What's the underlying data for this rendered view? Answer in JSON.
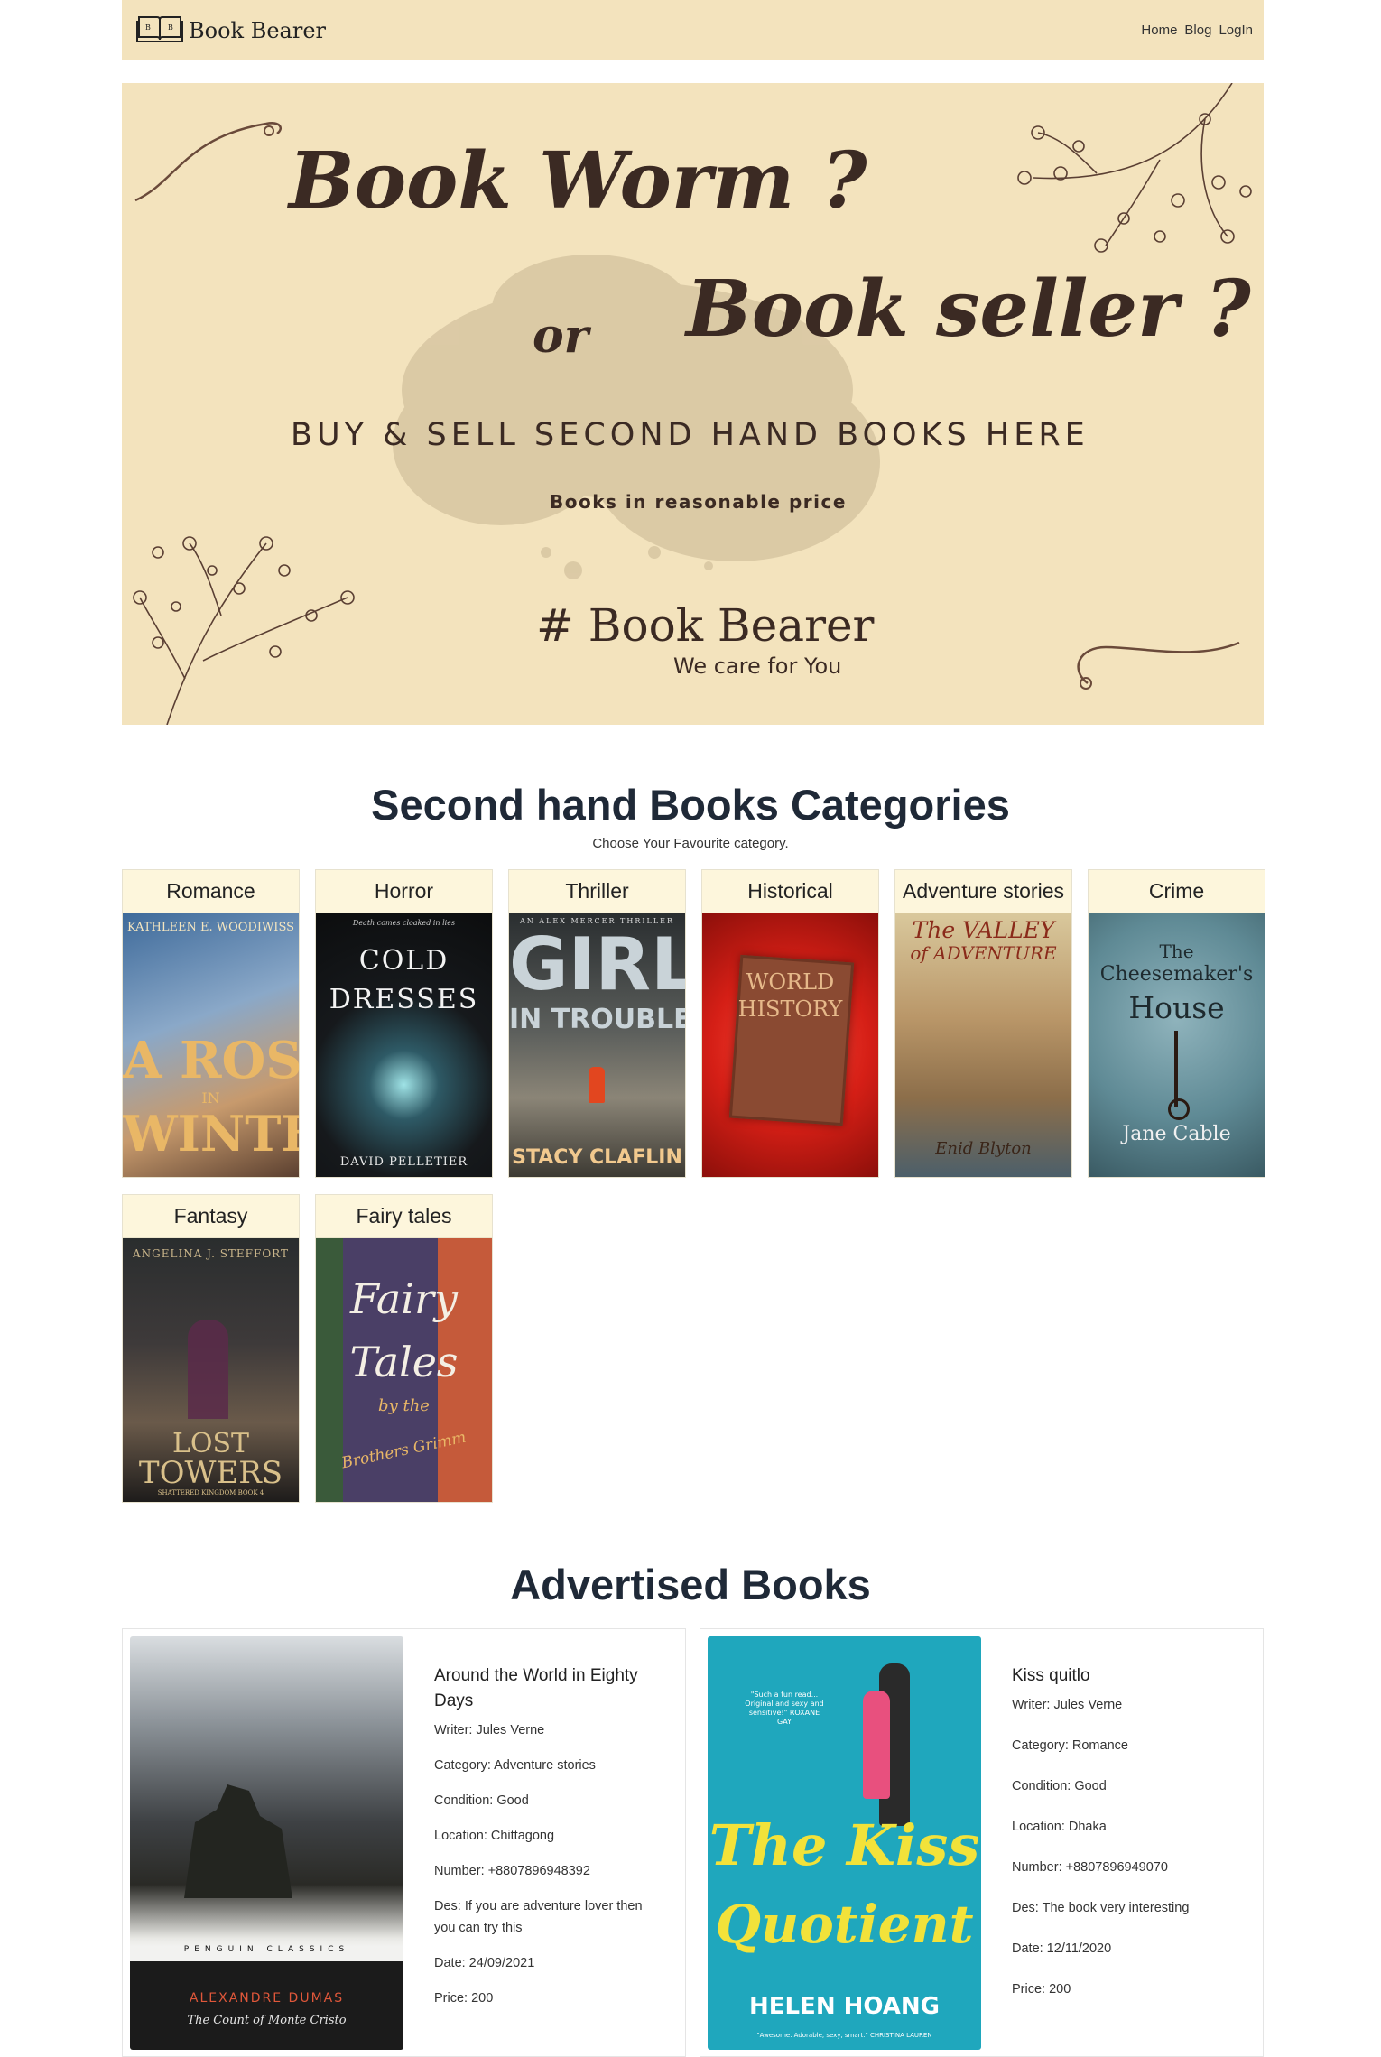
{
  "nav": {
    "brand": "Book Bearer",
    "links": [
      "Home",
      "Blog",
      "LogIn"
    ]
  },
  "banner": {
    "line1": "Book Worm ?",
    "or": "or",
    "line2": "Book seller ?",
    "tagline": "BUY & SELL SECOND HAND BOOKS HERE",
    "subtagline": "Books in reasonable price",
    "brand": "# Book Bearer",
    "motto": "We care for You"
  },
  "categories": {
    "title": "Second hand Books Categories",
    "subtitle": "Choose Your Favourite category.",
    "items": [
      {
        "label": "Romance",
        "cover_lines": [
          "KATHLEEN E. WOODIWISS",
          "A ROSE",
          "IN",
          "WINTER"
        ],
        "bg": "#6f8fb8"
      },
      {
        "label": "Horror",
        "cover_lines": [
          "Death comes cloaked in lies",
          "COLD",
          "DRESSES",
          "DAVID PELLETIER"
        ],
        "bg": "#1a1d20"
      },
      {
        "label": "Thriller",
        "cover_lines": [
          "AN ALEX MERCER THRILLER",
          "GIRL",
          "IN TROUBLE",
          "STACY CLAFLIN"
        ],
        "bg": "#3c3a35"
      },
      {
        "label": "Historical",
        "cover_lines": [
          "WORLD",
          "HISTORY"
        ],
        "bg": "#d8231c"
      },
      {
        "label": "Adventure stories",
        "cover_lines": [
          "The VALLEY",
          "of ADVENTURE",
          "Enid Blyton"
        ],
        "bg": "#c9b184"
      },
      {
        "label": "Crime",
        "cover_lines": [
          "The",
          "Cheesemaker's",
          "House",
          "Jane Cable"
        ],
        "bg": "#6b8f9a"
      },
      {
        "label": "Fantasy",
        "cover_lines": [
          "ANGELINA J. STEFFORT",
          "LOST",
          "TOWERS",
          "SHATTERED KINGDOM BOOK 4"
        ],
        "bg": "#2a2725"
      },
      {
        "label": "Fairy tales",
        "cover_lines": [
          "Fairy",
          "Tales",
          "by the",
          "Brothers Grimm"
        ],
        "bg": "#4a3f66"
      }
    ]
  },
  "advertised": {
    "title": "Advertised Books",
    "items": [
      {
        "title": "Around the World in Eighty Days",
        "writer": "Writer: Jules Verne",
        "category": "Category: Adventure stories",
        "condition": "Condition: Good",
        "location": "Location: Chittagong",
        "number": "Number: +8807896948392",
        "des": "Des: If you are adventure lover then you can try this",
        "date": "Date: 24/09/2021",
        "price": "Price: 200",
        "cover": {
          "publisher": "PENGUIN CLASSICS",
          "author": "ALEXANDRE DUMAS",
          "book": "The Count of Monte Cristo"
        }
      },
      {
        "title": "Kiss quitlo",
        "writer": "Writer: Jules Verne",
        "category": "Category: Romance",
        "condition": "Condition: Good",
        "location": "Location: Dhaka",
        "number": "Number: +8807896949070",
        "des": "Des: The book very interesting",
        "date": "Date: 12/11/2020",
        "price": "Price: 200",
        "cover": {
          "quote": "\"Such a fun read... Original and sexy and sensitive!\" ROXANE GAY",
          "line1": "The Kiss",
          "line2": "Quotient",
          "author": "HELEN HOANG",
          "footer": "\"Awesome. Adorable, sexy, smart.\" CHRISTINA LAUREN"
        }
      }
    ]
  },
  "colors": {
    "nav_bg": "#f3e3bd",
    "banner_bg": "#f3e3bd",
    "heading": "#1f2937",
    "cat_head_bg": "#fdf6dc",
    "banner_text": "#3b2a23"
  }
}
